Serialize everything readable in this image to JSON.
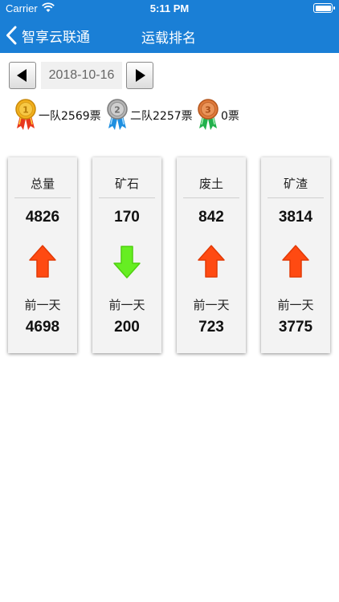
{
  "status_bar": {
    "carrier": "Carrier",
    "time": "5:11 PM"
  },
  "nav": {
    "back_label": "智享云联通",
    "title": "运载排名"
  },
  "date_selector": {
    "date": "2018-10-16"
  },
  "ranking": [
    {
      "text": "一队2569票",
      "medal": "gold-medal-icon"
    },
    {
      "text": "二队2257票",
      "medal": "silver-medal-icon"
    },
    {
      "text": "0票",
      "medal": "bronze-medal-icon"
    }
  ],
  "cards": [
    {
      "category": "总量",
      "value": "4826",
      "trend": "up",
      "prev_label": "前一天",
      "prev_value": "4698"
    },
    {
      "category": "矿石",
      "value": "170",
      "trend": "down",
      "prev_label": "前一天",
      "prev_value": "200"
    },
    {
      "category": "废土",
      "value": "842",
      "trend": "up",
      "prev_label": "前一天",
      "prev_value": "723"
    },
    {
      "category": "矿渣",
      "value": "3814",
      "trend": "up",
      "prev_label": "前一天",
      "prev_value": "3775"
    }
  ],
  "colors": {
    "header": "#1a7fd6",
    "up": "#ff4a12",
    "down": "#66ee22",
    "gold": "#f2b01c",
    "silver": "#a8a8a8",
    "bronze": "#e07a3a"
  }
}
